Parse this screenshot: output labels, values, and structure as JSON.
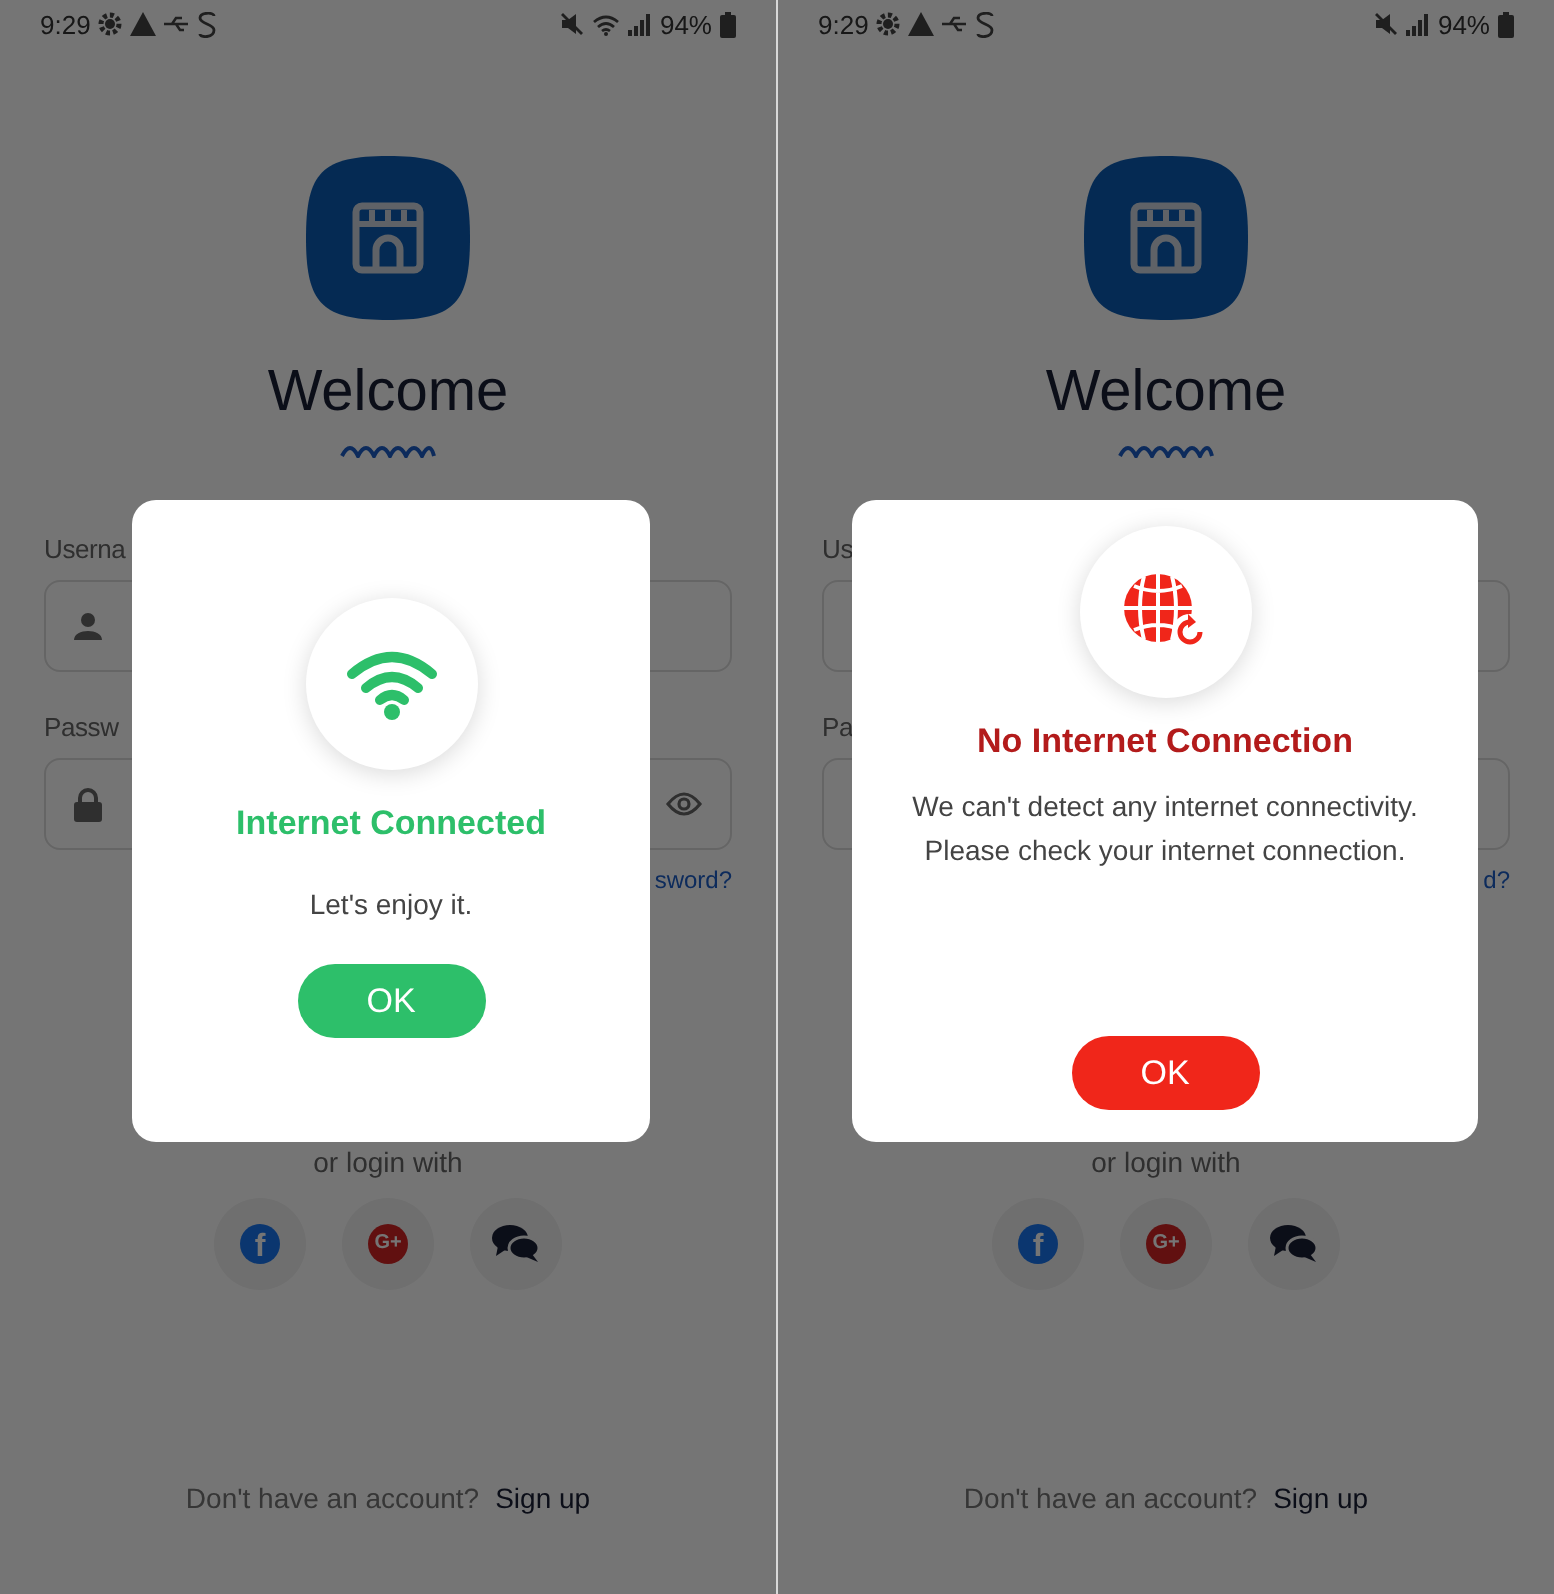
{
  "screens": [
    {
      "status_bar": {
        "time": "9:29",
        "battery": "94%",
        "wifi_on": true
      },
      "login": {
        "title": "Welcome",
        "username_label": "Userna",
        "password_label": "Passw",
        "forgot_link": "sword?",
        "alt_login": "or login with",
        "social": [
          {
            "kind": "facebook",
            "glyph": "f"
          },
          {
            "kind": "google",
            "glyph": "G+"
          },
          {
            "kind": "chat"
          }
        ],
        "footer_text": "Don't have an account?",
        "signup_link": "Sign up"
      },
      "dialog": {
        "kind": "success",
        "title": "Internet Connected",
        "message_lines": [
          "Let's enjoy it."
        ],
        "button": "OK"
      }
    },
    {
      "status_bar": {
        "time": "9:29",
        "battery": "94%",
        "wifi_on": false
      },
      "login": {
        "title": "Welcome",
        "username_label": "Us",
        "password_label": "Pa",
        "forgot_link": "d?",
        "alt_login": "or login with",
        "social": [
          {
            "kind": "facebook",
            "glyph": "f"
          },
          {
            "kind": "google",
            "glyph": "G+"
          },
          {
            "kind": "chat"
          }
        ],
        "footer_text": "Don't have an account?",
        "signup_link": "Sign up"
      },
      "dialog": {
        "kind": "error",
        "title": "No Internet Connection",
        "message_lines": [
          "We can't detect any internet connectivity.",
          "Please check your internet connection."
        ],
        "button": "OK"
      }
    }
  ]
}
